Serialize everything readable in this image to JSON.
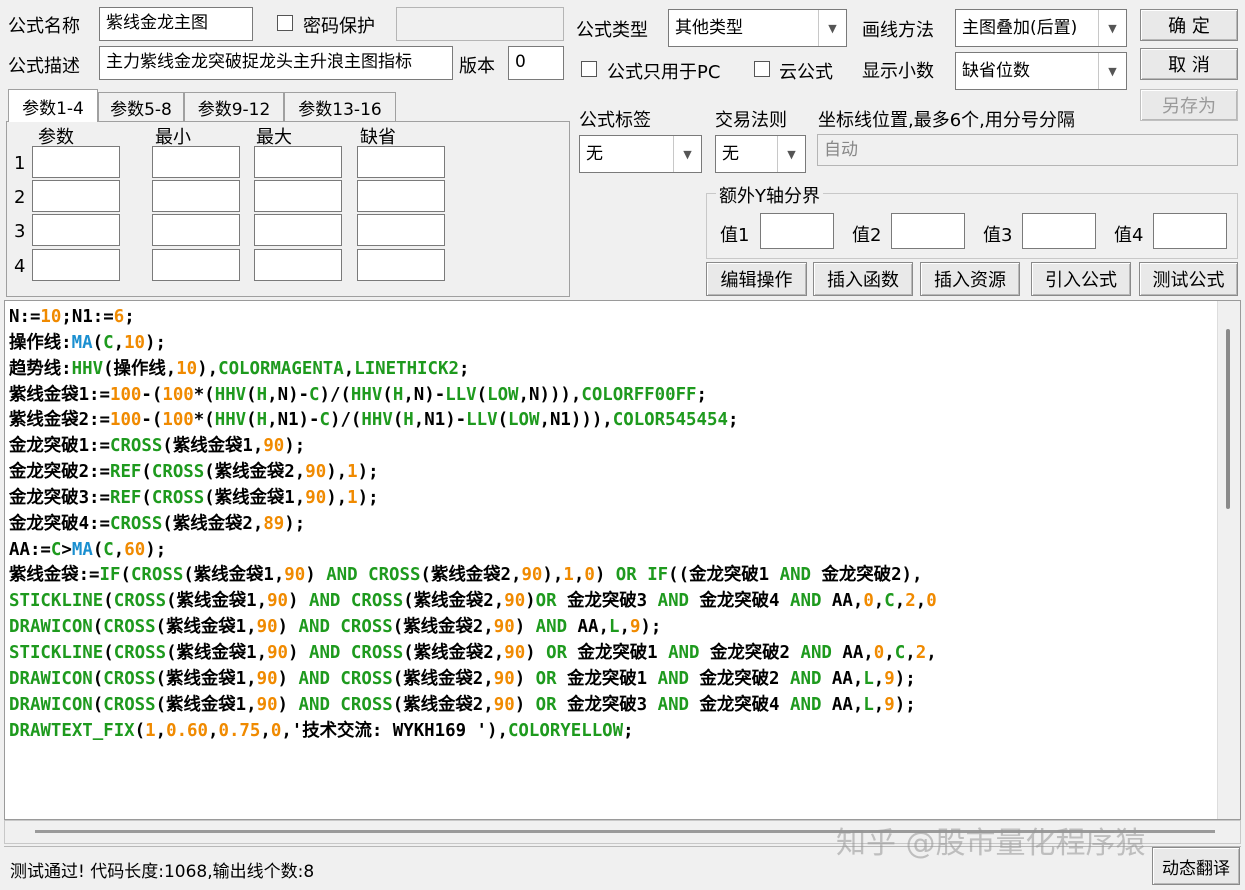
{
  "top": {
    "name_label": "公式名称",
    "name_value": "紫线金龙主图",
    "password_label": "密码保护",
    "desc_label": "公式描述",
    "desc_value": "主力紫线金龙突破捉龙头主升浪主图指标",
    "version_label": "版本",
    "version_value": "0"
  },
  "right": {
    "type_label": "公式类型",
    "type_value": "其他类型",
    "draw_label": "画线方法",
    "draw_value": "主图叠加(后置)",
    "pc_only_label": "公式只用于PC",
    "cloud_label": "云公式",
    "decimal_label": "显示小数",
    "decimal_value": "缺省位数",
    "tag_label": "公式标签",
    "tag_value": "无",
    "trade_label": "交易法则",
    "trade_value": "无",
    "coord_label": "坐标线位置,最多6个,用分号分隔",
    "coord_value": "自动",
    "yaxis_group": "额外Y轴分界",
    "y1": "值1",
    "y2": "值2",
    "y3": "值3",
    "y4": "值4"
  },
  "buttons": {
    "ok": "确  定",
    "cancel": "取  消",
    "save_as": "另存为",
    "edit": "编辑操作",
    "insert_func": "插入函数",
    "insert_res": "插入资源",
    "import": "引入公式",
    "test": "测试公式",
    "translate": "动态翻译"
  },
  "params": {
    "tabs": [
      "参数1-4",
      "参数5-8",
      "参数9-12",
      "参数13-16"
    ],
    "headers": [
      "参数",
      "最小",
      "最大",
      "缺省"
    ],
    "rows": [
      "1",
      "2",
      "3",
      "4"
    ]
  },
  "code_lines": [
    [
      [
        "k",
        "N:="
      ],
      [
        "n",
        "10"
      ],
      [
        "k",
        ";N1:="
      ],
      [
        "n",
        "6"
      ],
      [
        "k",
        ";"
      ]
    ],
    [
      [
        "k",
        "操作线:"
      ],
      [
        "m",
        "MA"
      ],
      [
        "k",
        "("
      ],
      [
        "f",
        "C"
      ],
      [
        "k",
        ","
      ],
      [
        "n",
        "10"
      ],
      [
        "k",
        ");"
      ]
    ],
    [
      [
        "k",
        "趋势线:"
      ],
      [
        "f",
        "HHV"
      ],
      [
        "k",
        "(操作线,"
      ],
      [
        "n",
        "10"
      ],
      [
        "k",
        "),"
      ],
      [
        "f",
        "COLORMAGENTA"
      ],
      [
        "k",
        ","
      ],
      [
        "f",
        "LINETHICK2"
      ],
      [
        "k",
        ";"
      ]
    ],
    [
      [
        "k",
        "紫线金袋1:="
      ],
      [
        "n",
        "100"
      ],
      [
        "k",
        "-("
      ],
      [
        "n",
        "100"
      ],
      [
        "k",
        "*("
      ],
      [
        "f",
        "HHV"
      ],
      [
        "k",
        "("
      ],
      [
        "f",
        "H"
      ],
      [
        "k",
        ",N)-"
      ],
      [
        "f",
        "C"
      ],
      [
        "k",
        ")/("
      ],
      [
        "f",
        "HHV"
      ],
      [
        "k",
        "("
      ],
      [
        "f",
        "H"
      ],
      [
        "k",
        ",N)-"
      ],
      [
        "f",
        "LLV"
      ],
      [
        "k",
        "("
      ],
      [
        "f",
        "LOW"
      ],
      [
        "k",
        ",N))),"
      ],
      [
        "f",
        "COLORFF00FF"
      ],
      [
        "k",
        ";"
      ]
    ],
    [
      [
        "k",
        "紫线金袋2:="
      ],
      [
        "n",
        "100"
      ],
      [
        "k",
        "-("
      ],
      [
        "n",
        "100"
      ],
      [
        "k",
        "*("
      ],
      [
        "f",
        "HHV"
      ],
      [
        "k",
        "("
      ],
      [
        "f",
        "H"
      ],
      [
        "k",
        ",N1)-"
      ],
      [
        "f",
        "C"
      ],
      [
        "k",
        ")/("
      ],
      [
        "f",
        "HHV"
      ],
      [
        "k",
        "("
      ],
      [
        "f",
        "H"
      ],
      [
        "k",
        ",N1)-"
      ],
      [
        "f",
        "LLV"
      ],
      [
        "k",
        "("
      ],
      [
        "f",
        "LOW"
      ],
      [
        "k",
        ",N1))),"
      ],
      [
        "f",
        "COLOR545454"
      ],
      [
        "k",
        ";"
      ]
    ],
    [
      [
        "k",
        "金龙突破1:="
      ],
      [
        "f",
        "CROSS"
      ],
      [
        "k",
        "(紫线金袋1,"
      ],
      [
        "n",
        "90"
      ],
      [
        "k",
        ");"
      ]
    ],
    [
      [
        "k",
        "金龙突破2:="
      ],
      [
        "f",
        "REF"
      ],
      [
        "k",
        "("
      ],
      [
        "f",
        "CROSS"
      ],
      [
        "k",
        "(紫线金袋2,"
      ],
      [
        "n",
        "90"
      ],
      [
        "k",
        "),"
      ],
      [
        "n",
        "1"
      ],
      [
        "k",
        ");"
      ]
    ],
    [
      [
        "k",
        "金龙突破3:="
      ],
      [
        "f",
        "REF"
      ],
      [
        "k",
        "("
      ],
      [
        "f",
        "CROSS"
      ],
      [
        "k",
        "(紫线金袋1,"
      ],
      [
        "n",
        "90"
      ],
      [
        "k",
        "),"
      ],
      [
        "n",
        "1"
      ],
      [
        "k",
        ");"
      ]
    ],
    [
      [
        "k",
        "金龙突破4:="
      ],
      [
        "f",
        "CROSS"
      ],
      [
        "k",
        "(紫线金袋2,"
      ],
      [
        "n",
        "89"
      ],
      [
        "k",
        ");"
      ]
    ],
    [
      [
        "k",
        "AA:="
      ],
      [
        "f",
        "C"
      ],
      [
        "k",
        ">"
      ],
      [
        "m",
        "MA"
      ],
      [
        "k",
        "("
      ],
      [
        "f",
        "C"
      ],
      [
        "k",
        ","
      ],
      [
        "n",
        "60"
      ],
      [
        "k",
        ");"
      ]
    ],
    [
      [
        "k",
        "紫线金袋:="
      ],
      [
        "f",
        "IF"
      ],
      [
        "k",
        "("
      ],
      [
        "f",
        "CROSS"
      ],
      [
        "k",
        "(紫线金袋1,"
      ],
      [
        "n",
        "90"
      ],
      [
        "k",
        ") "
      ],
      [
        "f",
        "AND"
      ],
      [
        "k",
        " "
      ],
      [
        "f",
        "CROSS"
      ],
      [
        "k",
        "(紫线金袋2,"
      ],
      [
        "n",
        "90"
      ],
      [
        "k",
        "),"
      ],
      [
        "n",
        "1"
      ],
      [
        "k",
        ","
      ],
      [
        "n",
        "0"
      ],
      [
        "k",
        ") "
      ],
      [
        "f",
        "OR"
      ],
      [
        "k",
        " "
      ],
      [
        "f",
        "IF"
      ],
      [
        "k",
        "((金龙突破1 "
      ],
      [
        "f",
        "AND"
      ],
      [
        "k",
        " 金龙突破2),"
      ]
    ],
    [
      [
        "b",
        "STICKLINE"
      ],
      [
        "k",
        "("
      ],
      [
        "f",
        "CROSS"
      ],
      [
        "k",
        "(紫线金袋1,"
      ],
      [
        "n",
        "90"
      ],
      [
        "k",
        ") "
      ],
      [
        "f",
        "AND"
      ],
      [
        "k",
        " "
      ],
      [
        "f",
        "CROSS"
      ],
      [
        "k",
        "(紫线金袋2,"
      ],
      [
        "n",
        "90"
      ],
      [
        "k",
        ")"
      ],
      [
        "f",
        "OR"
      ],
      [
        "k",
        " 金龙突破3 "
      ],
      [
        "f",
        "AND"
      ],
      [
        "k",
        " 金龙突破4 "
      ],
      [
        "f",
        "AND"
      ],
      [
        "k",
        " AA,"
      ],
      [
        "n",
        "0"
      ],
      [
        "k",
        ","
      ],
      [
        "f",
        "C"
      ],
      [
        "k",
        ","
      ],
      [
        "n",
        "2"
      ],
      [
        "k",
        ","
      ],
      [
        "n",
        "0"
      ]
    ],
    [
      [
        "b",
        "DRAWICON"
      ],
      [
        "k",
        "("
      ],
      [
        "f",
        "CROSS"
      ],
      [
        "k",
        "(紫线金袋1,"
      ],
      [
        "n",
        "90"
      ],
      [
        "k",
        ") "
      ],
      [
        "f",
        "AND"
      ],
      [
        "k",
        " "
      ],
      [
        "f",
        "CROSS"
      ],
      [
        "k",
        "(紫线金袋2,"
      ],
      [
        "n",
        "90"
      ],
      [
        "k",
        ") "
      ],
      [
        "f",
        "AND"
      ],
      [
        "k",
        " AA,"
      ],
      [
        "f",
        "L"
      ],
      [
        "k",
        ","
      ],
      [
        "n",
        "9"
      ],
      [
        "k",
        ");"
      ]
    ],
    [
      [
        "b",
        "STICKLINE"
      ],
      [
        "k",
        "("
      ],
      [
        "f",
        "CROSS"
      ],
      [
        "k",
        "(紫线金袋1,"
      ],
      [
        "n",
        "90"
      ],
      [
        "k",
        ") "
      ],
      [
        "f",
        "AND"
      ],
      [
        "k",
        " "
      ],
      [
        "f",
        "CROSS"
      ],
      [
        "k",
        "(紫线金袋2,"
      ],
      [
        "n",
        "90"
      ],
      [
        "k",
        ") "
      ],
      [
        "f",
        "OR"
      ],
      [
        "k",
        " 金龙突破1 "
      ],
      [
        "f",
        "AND"
      ],
      [
        "k",
        " 金龙突破2 "
      ],
      [
        "f",
        "AND"
      ],
      [
        "k",
        " AA,"
      ],
      [
        "n",
        "0"
      ],
      [
        "k",
        ","
      ],
      [
        "f",
        "C"
      ],
      [
        "k",
        ","
      ],
      [
        "n",
        "2"
      ],
      [
        "k",
        ","
      ]
    ],
    [
      [
        "b",
        "DRAWICON"
      ],
      [
        "k",
        "("
      ],
      [
        "f",
        "CROSS"
      ],
      [
        "k",
        "(紫线金袋1,"
      ],
      [
        "n",
        "90"
      ],
      [
        "k",
        ") "
      ],
      [
        "f",
        "AND"
      ],
      [
        "k",
        " "
      ],
      [
        "f",
        "CROSS"
      ],
      [
        "k",
        "(紫线金袋2,"
      ],
      [
        "n",
        "90"
      ],
      [
        "k",
        ") "
      ],
      [
        "f",
        "OR"
      ],
      [
        "k",
        " 金龙突破1 "
      ],
      [
        "f",
        "AND"
      ],
      [
        "k",
        " 金龙突破2 "
      ],
      [
        "f",
        "AND"
      ],
      [
        "k",
        " AA,"
      ],
      [
        "f",
        "L"
      ],
      [
        "k",
        ","
      ],
      [
        "n",
        "9"
      ],
      [
        "k",
        ");"
      ]
    ],
    [
      [
        "b",
        "DRAWICON"
      ],
      [
        "k",
        "("
      ],
      [
        "f",
        "CROSS"
      ],
      [
        "k",
        "(紫线金袋1,"
      ],
      [
        "n",
        "90"
      ],
      [
        "k",
        ") "
      ],
      [
        "f",
        "AND"
      ],
      [
        "k",
        " "
      ],
      [
        "f",
        "CROSS"
      ],
      [
        "k",
        "(紫线金袋2,"
      ],
      [
        "n",
        "90"
      ],
      [
        "k",
        ") "
      ],
      [
        "f",
        "OR"
      ],
      [
        "k",
        " 金龙突破3 "
      ],
      [
        "f",
        "AND"
      ],
      [
        "k",
        " 金龙突破4 "
      ],
      [
        "f",
        "AND"
      ],
      [
        "k",
        " AA,"
      ],
      [
        "f",
        "L"
      ],
      [
        "k",
        ","
      ],
      [
        "n",
        "9"
      ],
      [
        "k",
        ");"
      ]
    ],
    [
      [
        "b",
        "DRAWTEXT_FIX"
      ],
      [
        "k",
        "("
      ],
      [
        "n",
        "1"
      ],
      [
        "k",
        ","
      ],
      [
        "n",
        "0.60"
      ],
      [
        "k",
        ","
      ],
      [
        "n",
        "0.75"
      ],
      [
        "k",
        ","
      ],
      [
        "n",
        "0"
      ],
      [
        "k",
        ",'技术交流: WYKH169 '),"
      ],
      [
        "f",
        "COLORYELLOW"
      ],
      [
        "k",
        ";"
      ]
    ]
  ],
  "status_text": "测试通过! 代码长度:1068,输出线个数:8",
  "watermark": "知乎 @股市量化程序猿",
  "colors": {
    "number": "#f08a00",
    "function": "#1e9a1e",
    "ma": "#1a8fd0",
    "text": "#000000"
  }
}
